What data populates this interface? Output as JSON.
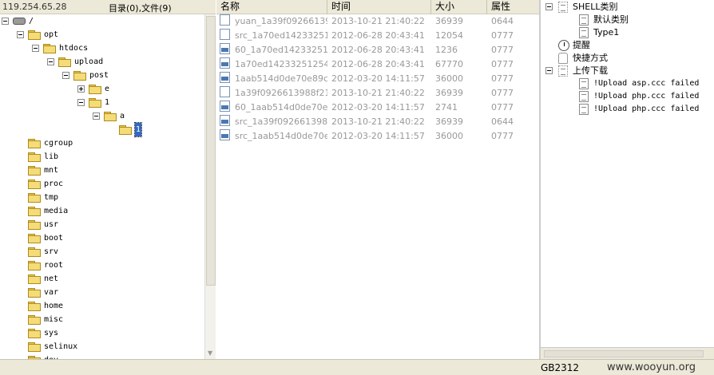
{
  "header": {
    "address": "119.254.65.28",
    "counts": "目录(0),文件(9)"
  },
  "file_list": {
    "columns": {
      "name": "名称",
      "time": "时间",
      "size": "大小",
      "perm": "属性"
    },
    "rows": [
      {
        "name": "yuan_1a39f09266139...",
        "time": "2013-10-21 21:40:22",
        "size": "36939",
        "perm": "0644",
        "icon": "file-icon"
      },
      {
        "name": "src_1a70ed14233251...",
        "time": "2012-06-28 20:43:41",
        "size": "12054",
        "perm": "0777",
        "icon": "file-icon"
      },
      {
        "name": "60_1a70ed142332512...",
        "time": "2012-06-28 20:43:41",
        "size": "1236",
        "perm": "0777",
        "icon": "image-file-icon"
      },
      {
        "name": "1a70ed142332512547...",
        "time": "2012-06-28 20:43:41",
        "size": "67770",
        "perm": "0777",
        "icon": "image-file-icon"
      },
      {
        "name": "1aab514d0de70e89cc...",
        "time": "2012-03-20 14:11:57",
        "size": "36000",
        "perm": "0777",
        "icon": "image-file-icon"
      },
      {
        "name": "1a39f0926613988f21...",
        "time": "2013-10-21 21:40:22",
        "size": "36939",
        "perm": "0777",
        "icon": "file-icon"
      },
      {
        "name": "60_1aab514d0de70e8...",
        "time": "2012-03-20 14:11:57",
        "size": "2741",
        "perm": "0777",
        "icon": "image-file-icon"
      },
      {
        "name": "src_1a39f0926613988...",
        "time": "2013-10-21 21:40:22",
        "size": "36939",
        "perm": "0644",
        "icon": "image-file-icon"
      },
      {
        "name": "src_1aab514d0de70e...",
        "time": "2012-03-20 14:11:57",
        "size": "36000",
        "perm": "0777",
        "icon": "image-file-icon"
      }
    ]
  },
  "tree": [
    {
      "label": "/",
      "depth": 0,
      "type": "drive",
      "expander": "minus"
    },
    {
      "label": "opt",
      "depth": 1,
      "type": "folder",
      "expander": "minus"
    },
    {
      "label": "htdocs",
      "depth": 2,
      "type": "folder",
      "expander": "minus"
    },
    {
      "label": "upload",
      "depth": 3,
      "type": "folder",
      "expander": "minus"
    },
    {
      "label": "post",
      "depth": 4,
      "type": "folder",
      "expander": "minus"
    },
    {
      "label": "e",
      "depth": 5,
      "type": "folder",
      "expander": "plus"
    },
    {
      "label": "1",
      "depth": 5,
      "type": "folder",
      "expander": "minus"
    },
    {
      "label": "a",
      "depth": 6,
      "type": "folder",
      "expander": "minus"
    },
    {
      "label": "1",
      "depth": 7,
      "type": "folder",
      "expander": "none",
      "selected": true
    },
    {
      "label": "cgroup",
      "depth": 1,
      "type": "folder",
      "expander": "none"
    },
    {
      "label": "lib",
      "depth": 1,
      "type": "folder",
      "expander": "none"
    },
    {
      "label": "mnt",
      "depth": 1,
      "type": "folder",
      "expander": "none"
    },
    {
      "label": "proc",
      "depth": 1,
      "type": "folder",
      "expander": "none"
    },
    {
      "label": "tmp",
      "depth": 1,
      "type": "folder",
      "expander": "none"
    },
    {
      "label": "media",
      "depth": 1,
      "type": "folder",
      "expander": "none"
    },
    {
      "label": "usr",
      "depth": 1,
      "type": "folder",
      "expander": "none"
    },
    {
      "label": "boot",
      "depth": 1,
      "type": "folder",
      "expander": "none"
    },
    {
      "label": "srv",
      "depth": 1,
      "type": "folder",
      "expander": "none"
    },
    {
      "label": "root",
      "depth": 1,
      "type": "folder",
      "expander": "none"
    },
    {
      "label": "net",
      "depth": 1,
      "type": "folder",
      "expander": "none"
    },
    {
      "label": "var",
      "depth": 1,
      "type": "folder",
      "expander": "none"
    },
    {
      "label": "home",
      "depth": 1,
      "type": "folder",
      "expander": "none"
    },
    {
      "label": "misc",
      "depth": 1,
      "type": "folder",
      "expander": "none"
    },
    {
      "label": "sys",
      "depth": 1,
      "type": "folder",
      "expander": "none"
    },
    {
      "label": "selinux",
      "depth": 1,
      "type": "folder",
      "expander": "none"
    },
    {
      "label": "dev",
      "depth": 1,
      "type": "folder",
      "expander": "none"
    }
  ],
  "right_tree": [
    {
      "label": "SHELL类别",
      "depth": 0,
      "icon": "dotted-box-icon",
      "expander": "minus",
      "mono": false
    },
    {
      "label": "默认类别",
      "depth": 1,
      "icon": "document-icon",
      "expander": "none",
      "mono": false
    },
    {
      "label": "Type1",
      "depth": 1,
      "icon": "document-icon",
      "expander": "none",
      "mono": false
    },
    {
      "label": "提醒",
      "depth": 0,
      "icon": "clock-icon",
      "expander": "none",
      "mono": false
    },
    {
      "label": "快捷方式",
      "depth": 0,
      "icon": "hand-icon",
      "expander": "none",
      "mono": false
    },
    {
      "label": "上传下载",
      "depth": 0,
      "icon": "dotted-box-icon",
      "expander": "minus",
      "mono": false
    },
    {
      "label": "!Upload asp.ccc failed",
      "depth": 1,
      "icon": "document-icon",
      "expander": "none",
      "mono": true
    },
    {
      "label": "!Upload php.ccc failed",
      "depth": 1,
      "icon": "document-icon",
      "expander": "none",
      "mono": true
    },
    {
      "label": "!Upload php.ccc failed",
      "depth": 1,
      "icon": "document-icon",
      "expander": "none",
      "mono": true
    }
  ],
  "status": {
    "encoding": "GB2312",
    "watermark": "www.wooyun.org"
  },
  "colors": {
    "chrome": "#ece9d8",
    "selection": "#316ac5",
    "muted_text": "#999999",
    "folder": "#f4dc78"
  }
}
